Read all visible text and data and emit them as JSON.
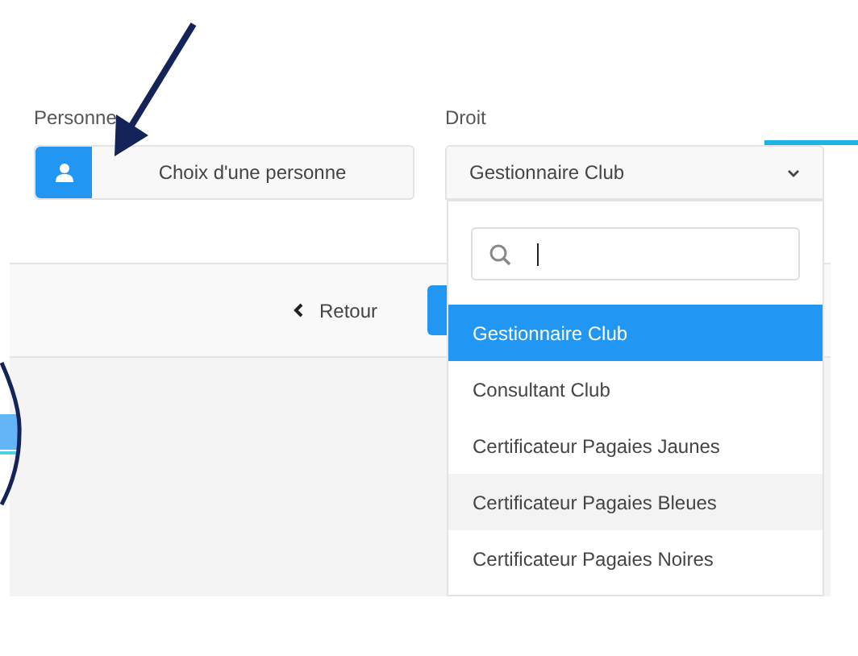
{
  "person": {
    "label": "Personne",
    "button": "Choix d'une personne"
  },
  "right": {
    "label": "Droit",
    "value": "Gestionnaire Club",
    "expanded": true
  },
  "footer": {
    "back": "Retour"
  },
  "options": [
    {
      "label": "Gestionnaire Club",
      "selected": true,
      "hovered": false
    },
    {
      "label": "Consultant Club",
      "selected": false,
      "hovered": false
    },
    {
      "label": "Certificateur Pagaies Jaunes",
      "selected": false,
      "hovered": false
    },
    {
      "label": "Certificateur Pagaies Bleues",
      "selected": false,
      "hovered": true
    },
    {
      "label": "Certificateur Pagaies Noires",
      "selected": false,
      "hovered": false
    }
  ]
}
